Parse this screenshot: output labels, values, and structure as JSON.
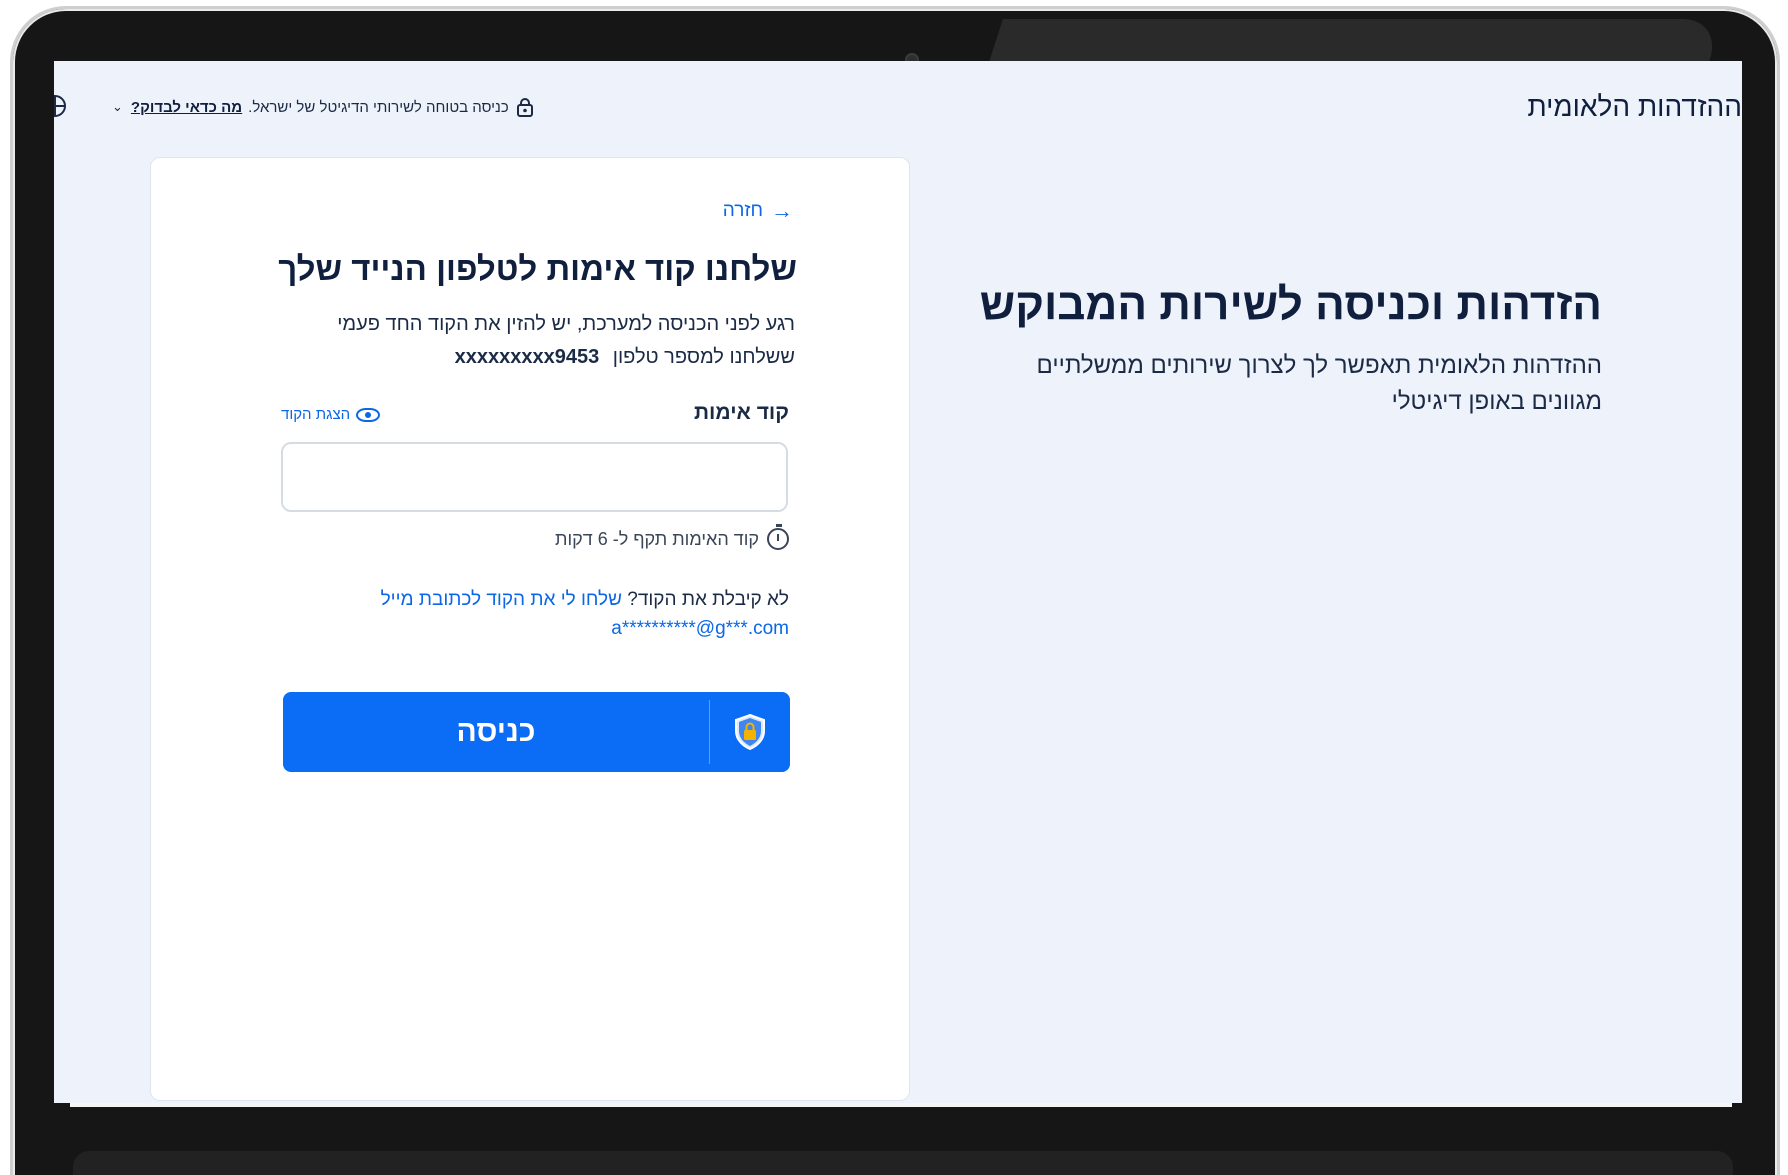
{
  "header": {
    "title": "ההזדהות הלאומית",
    "secure_note": "כניסה בטוחה לשירותי הדיגיטל של ישראל.",
    "secure_link": "מה כדאי לבדוק?"
  },
  "hero": {
    "title": "הזדהות וכניסה לשירות המבוקש",
    "subtitle": "ההזדהות הלאומית תאפשר לך לצרוך שירותים ממשלתיים מגוונים באופן דיגיטלי"
  },
  "card": {
    "back_label": "חזרה",
    "title": "שלחנו קוד אימות לטלפון הנייד שלך",
    "description": "רגע לפני הכניסה למערכת, יש להזין את הקוד החד פעמי ששלחנו למספר טלפון",
    "phone": "xxxxxxxxx9453",
    "field_label": "קוד אימות",
    "show_code_label": "הצגת הקוד",
    "code_value": "",
    "timer_note": "קוד האימות תקף ל- 6 דקות",
    "resend_question": "לא קיבלת את הקוד?",
    "resend_link": "שלחו לי את הקוד לכתובת מייל",
    "email": "a**********@g***.com",
    "submit_label": "כניסה"
  },
  "icons": {
    "back": "arrow-right-icon",
    "lock": "lock-icon",
    "globe": "globe-icon",
    "eye": "eye-icon",
    "timer": "stopwatch-icon",
    "shield": "shield-lock-icon"
  },
  "colors": {
    "primary": "#0b6cf5",
    "link": "#0b67e8",
    "text_dark": "#0f1f3d",
    "background": "#eef3fb"
  }
}
